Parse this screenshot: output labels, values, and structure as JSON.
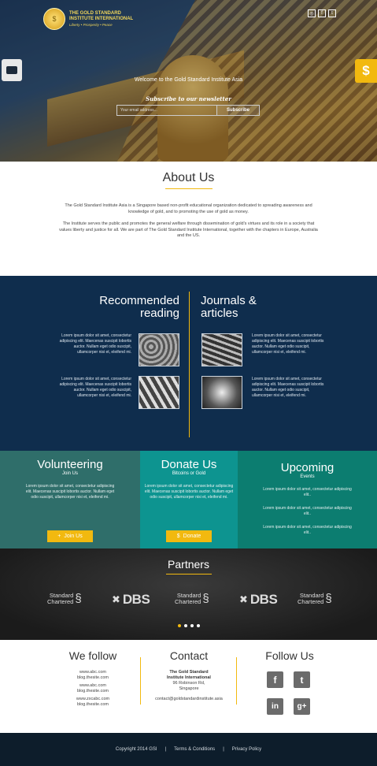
{
  "hero": {
    "logo_mark": "$",
    "logo_line1": "THE GOLD STANDARD",
    "logo_line2": "INSTITUTE INTERNATIONAL",
    "logo_tagline": "Liberty  •  Prosperity  •  Peace",
    "social_icons": [
      "instagram-icon",
      "facebook-icon",
      "twitter-icon"
    ],
    "social_glyphs": [
      "◎",
      "f",
      "t"
    ],
    "chat_tab_icon": "chat-icon",
    "dollar_tab_label": "$",
    "welcome": "Welcome to the Gold Standard Institute Asia",
    "subscribe_title": "Subscribe to our newsletter",
    "email_placeholder": "Your email address...",
    "subscribe_button": "Subscribe"
  },
  "about": {
    "title": "About Us",
    "p1": "The Gold Standard Institute Asia is a Singapore based non-profit educational organization dedicated to spreading awareness and knowledge of gold, and to promoting the use of gold as money.",
    "p2": "The Institute serves the public and promotes the general welfare through dissemination of gold's virtues and its role in a society that values liberty and justice for all. We are part of The Gold Standard Institute International, together with the chapters in Europe, Australia and the US."
  },
  "reading": {
    "left_title_1": "Recommended",
    "left_title_2": "reading",
    "right_title_1": "Journals &",
    "right_title_2": "articles",
    "lorem": "Lorem ipsum dolor sit amet, consectetur adipiscing elit. Maecenas suscipit lobortis auctor. Nullam eget odio suscipit, ullamcorper nisi et, eleifend mi."
  },
  "volunteer": {
    "title": "Volunteering",
    "subtitle": "Join Us",
    "text": "Lorem ipsum dolor sit amet, consectetur adipiscing elit. Maecenas suscipit lobortis auctor. Nullam eget odio suscipit, ullamcorper nisi et, eleifend mi.",
    "button": "Join Us",
    "button_icon": "+"
  },
  "donate": {
    "title": "Donate Us",
    "subtitle": "Bitcoins or Gold",
    "text": "Lorem ipsum dolor sit amet, consectetur adipiscing elit. Maecenas suscipit lobortis auctor. Nullam eget odio suscipit, ullamcorper nisi et, eleifend mi.",
    "button": "Donate",
    "button_icon": "$"
  },
  "events": {
    "title": "Upcoming",
    "subtitle": "Events",
    "items": [
      "Lorem ipsum dolor sit amet, consectetur adipiscing elit..",
      "Lorem ipsum dolor sit amet, consectetur adipiscing elit..",
      "Lorem ipsum dolor sit amet, consectetur adipiscing elit.."
    ]
  },
  "partners": {
    "title": "Partners",
    "logos": [
      {
        "line1": "Standard",
        "line2": "Chartered"
      },
      {
        "name": "DBS"
      },
      {
        "line1": "Standard",
        "line2": "Chartered"
      },
      {
        "name": "DBS"
      },
      {
        "line1": "Standard",
        "line2": "Chartered"
      }
    ],
    "carousel_dots": 4,
    "active_dot": 1
  },
  "follow": {
    "title": "We follow",
    "links": [
      "www.abc.com",
      "blog.thesite.com",
      "www.abc.com",
      "blog.thesite.com",
      "www.zxcabc.com",
      "blog.thesite.com"
    ]
  },
  "contact": {
    "title": "Contact",
    "org_line1": "The Gold Standard",
    "org_line2": "Institute International",
    "addr_line1": "96 Robinson Rd,",
    "addr_line2": "Singapore",
    "email": "contact@goldstandardinstitute.asia"
  },
  "followus": {
    "title": "Follow Us",
    "icons": [
      "facebook-icon",
      "twitter-icon",
      "linkedin-icon",
      "google-plus-icon"
    ],
    "glyphs": [
      "f",
      "t",
      "in",
      "g+"
    ]
  },
  "bottom": {
    "copyright": "Copyright 2014 GSI",
    "sep": "|",
    "terms": "Terms & Conditions",
    "privacy": "Privacy Policy"
  },
  "colors": {
    "accent": "#f2b90f",
    "navy": "#0f2d4d",
    "teal_dark": "#2f6e6a",
    "teal": "#0d9490",
    "teal_mid": "#0c7d70",
    "footer_bar": "#0d1d2b"
  }
}
